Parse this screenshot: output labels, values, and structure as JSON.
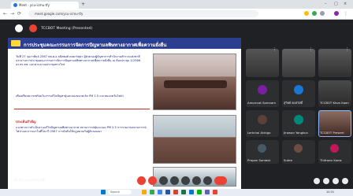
{
  "browser": {
    "tab_title": "Meet - ycu-icmu-tfy",
    "new_tab": "+",
    "address": "meet.google.com/ycu-icmu-tfy",
    "window_controls": [
      "–",
      "□",
      "×"
    ]
  },
  "meet": {
    "header_title": "TCCBOT Meeting (Presented)",
    "footer_text": "10:31 | ycu-icmu-tfy"
  },
  "slide": {
    "title": "การประชุมคณะกรรมการจัดการปัญหามลพิษทางอากาศเพื่อความยั่งยืน",
    "para1": "วันที่ 27 กุมภาพันธ์ 2567 พล.ต.อ.ธนิตพงศ์ ดลฮาร์สุดา ผู้ช่วยรองผู้บัญชาการสำนักงานตำรวจแห่งชาติ ประธานการประชุมคณะกรรมการจัดการปัญหามลพิษทางอากาศเพื่อความยั่งยืน ณ ห้องประชุม 1/2566 สง.ตร.ตช. และผ่านระบบประชุมทางไกล",
    "para2": "เพื่อเตรียมความพร้อมในการแก้ไขปัญหาฝุ่นละอองขนาดเล็ก PM 2.5 และหมอกควันไฟป่า",
    "section_title": "ประเด็นสำคัญ",
    "bullets": "แนวทางการดำเนินงานแก้ไขปัญหามลพิษทางอากาศ สถานการณ์ฝุ่นละออง PM 2.5 การรายงานสถานการณ์ไฟป่าและการเผาในที่โล่ง ปี 2567 การบังคับใช้กฎหมายกับผู้ลักลอบเผา"
  },
  "tiles": [
    {
      "name": ""
    },
    {
      "name": ""
    },
    {
      "name": "Amornrat Somnam",
      "initial": "A",
      "color": "#7b1fa2"
    },
    {
      "name": "สุวิทย์ คงสวัสดิ์",
      "initial": "ส",
      "color": "#1976d2"
    },
    {
      "name": "TCCBOT Khon Kaen",
      "initial": "",
      "color": ""
    },
    {
      "name": "Lertchai Ahkigo",
      "initial": "L",
      "color": "#5d4037"
    },
    {
      "name": "Jirawan Yangkun",
      "initial": "J",
      "color": "#00897b"
    },
    {
      "name": "TCCBOT Present",
      "initial": "",
      "color": ""
    },
    {
      "name": "Prapan Sombat",
      "initial": "P",
      "color": "#455a64"
    },
    {
      "name": "Sutee",
      "initial": "S",
      "color": "#6d4c41"
    },
    {
      "name": "Thitiwan Kaew",
      "initial": "T",
      "color": "#c2185b"
    }
  ],
  "taskbar": {
    "search": "Search",
    "time": "10:31",
    "date": "27/2/2567"
  },
  "colors": {
    "slide_header": "#2c3e8f",
    "end_call": "#ea4335",
    "present": "#1a73e8"
  }
}
